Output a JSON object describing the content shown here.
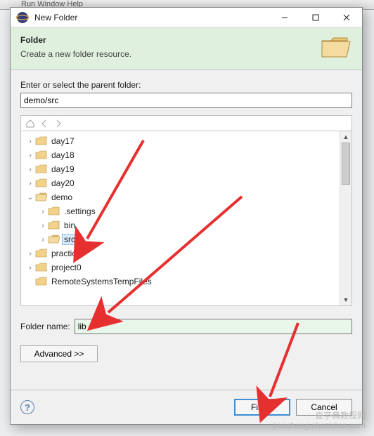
{
  "bg_menu_hint": "Run   Window   Help",
  "titlebar": {
    "title": "New Folder"
  },
  "header": {
    "title": "Folder",
    "desc": "Create a new folder resource."
  },
  "parent_label": "Enter or select the parent folder:",
  "parent_value": "demo/src",
  "tree": [
    {
      "label": "day17",
      "depth": 0,
      "expand": "collapsed",
      "open": false,
      "selected": false
    },
    {
      "label": "day18",
      "depth": 0,
      "expand": "collapsed",
      "open": false,
      "selected": false
    },
    {
      "label": "day19",
      "depth": 0,
      "expand": "collapsed",
      "open": false,
      "selected": false
    },
    {
      "label": "day20",
      "depth": 0,
      "expand": "collapsed",
      "open": false,
      "selected": false
    },
    {
      "label": "demo",
      "depth": 0,
      "expand": "expanded",
      "open": true,
      "selected": false
    },
    {
      "label": ".settings",
      "depth": 1,
      "expand": "collapsed",
      "open": false,
      "selected": false
    },
    {
      "label": "bin",
      "depth": 1,
      "expand": "collapsed",
      "open": false,
      "selected": false
    },
    {
      "label": "src",
      "depth": 1,
      "expand": "collapsed",
      "open": true,
      "selected": true
    },
    {
      "label": "practice",
      "depth": 0,
      "expand": "collapsed",
      "open": false,
      "selected": false
    },
    {
      "label": "project0",
      "depth": 0,
      "expand": "collapsed",
      "open": false,
      "selected": false
    },
    {
      "label": "RemoteSystemsTempFiles",
      "depth": 0,
      "expand": "none",
      "open": false,
      "selected": false
    }
  ],
  "folder_name_label": "Folder name:",
  "folder_name_value": "lib",
  "advanced_label": "Advanced >>",
  "footer": {
    "finish": "Finish",
    "cancel": "Cancel"
  },
  "watermark": {
    "line1": "查字典教程网",
    "line2": "jiaocheng.chazidian.com"
  },
  "colors": {
    "arrow": "#e63030",
    "header_band": "#dff0df",
    "focus": "#5a9bd5"
  }
}
